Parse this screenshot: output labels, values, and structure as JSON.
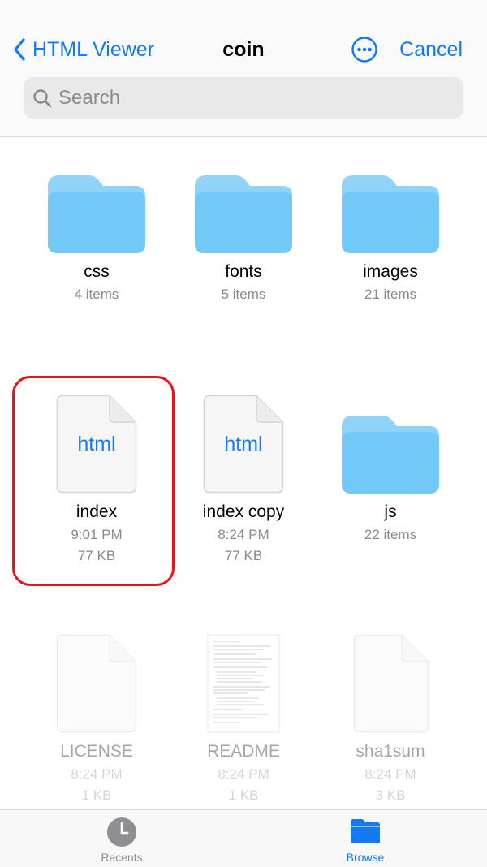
{
  "nav": {
    "back_label": "HTML Viewer",
    "title": "coin",
    "cancel_label": "Cancel"
  },
  "search": {
    "placeholder": "Search"
  },
  "items": [
    {
      "name": "css",
      "line1": "4 items",
      "line2": "",
      "type": "folder"
    },
    {
      "name": "fonts",
      "line1": "5 items",
      "line2": "",
      "type": "folder"
    },
    {
      "name": "images",
      "line1": "21 items",
      "line2": "",
      "type": "folder"
    },
    {
      "name": "index",
      "line1": "9:01 PM",
      "line2": "77 KB",
      "type": "html",
      "icon_text": "html"
    },
    {
      "name": "index copy",
      "line1": "8:24 PM",
      "line2": "77 KB",
      "type": "html",
      "icon_text": "html"
    },
    {
      "name": "js",
      "line1": "22 items",
      "line2": "",
      "type": "folder"
    },
    {
      "name": "LICENSE",
      "line1": "8:24 PM",
      "line2": "1 KB",
      "type": "document"
    },
    {
      "name": "README",
      "line1": "8:24 PM",
      "line2": "1 KB",
      "type": "text-document"
    },
    {
      "name": "sha1sum",
      "line1": "8:24 PM",
      "line2": "3 KB",
      "type": "document"
    }
  ],
  "tabs": [
    {
      "label": "Recents",
      "icon": "clock-icon",
      "active": false
    },
    {
      "label": "Browse",
      "icon": "folder-icon",
      "active": true
    }
  ],
  "colors": {
    "accent": "#1479f5",
    "folder": "#72c9f6",
    "selection": "#e5151a"
  }
}
